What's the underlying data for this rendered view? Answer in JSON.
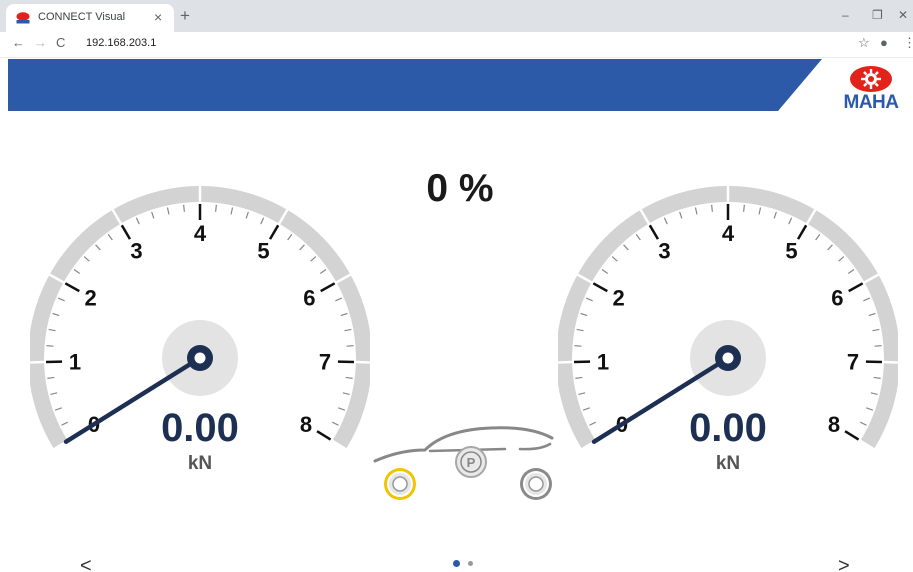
{
  "browser": {
    "tab_title": "CONNECT Visual",
    "url": "192.168.203.1",
    "icons": [
      "maha-favicon",
      "close-icon",
      "plus-icon",
      "minimize-icon",
      "restore-icon",
      "close-window-icon",
      "back-arrow-icon",
      "forward-arrow-icon",
      "reload-icon",
      "star-icon",
      "profile-icon",
      "menu-dots-icon"
    ]
  },
  "header": {
    "logo_text": "MAHA",
    "colors": {
      "banner": "#2c5aa8",
      "logo_red": "#e2231a"
    }
  },
  "display": {
    "percent_text": "0 %"
  },
  "gauges": [
    {
      "name": "left",
      "value_text": "0.00",
      "unit": "kN",
      "value": 0,
      "ticks": [
        "0",
        "1",
        "2",
        "3",
        "4",
        "5",
        "6",
        "7",
        "8"
      ]
    },
    {
      "name": "right",
      "value_text": "0.00",
      "unit": "kN",
      "value": 0,
      "ticks": [
        "0",
        "1",
        "2",
        "3",
        "4",
        "5",
        "6",
        "7",
        "8"
      ]
    }
  ],
  "car": {
    "parking_brake_label": "P",
    "colors": {
      "front_wheel_ring": "#f2c300",
      "rear_wheel_ring": "#888888",
      "body": "#888888"
    }
  },
  "pager": {
    "prev_label": "<",
    "next_label": ">",
    "pages_total": 2,
    "current_page": 1
  },
  "colors": {
    "needle": "#1d2f52",
    "gauge_band": "#d3d3d3",
    "hub": "#e3e3e3"
  }
}
